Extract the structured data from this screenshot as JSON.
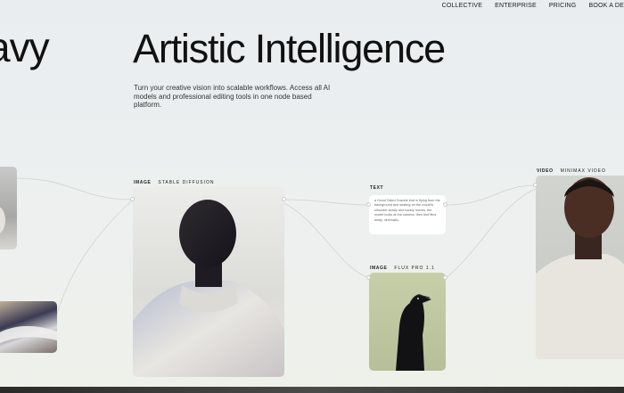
{
  "nav": {
    "items": [
      "COLLECTIVE",
      "ENTERPRISE",
      "PRICING",
      "BOOK A DE"
    ]
  },
  "brand": {
    "text": "avy"
  },
  "hero": {
    "title": "Artistic Intelligence",
    "subtitle": "Turn your creative vision into scalable workflows. Access all AI models and professional editing tools in one node based platform."
  },
  "nodes": {
    "stable": {
      "type": "IMAGE",
      "model": "STABLE DIFFUSION"
    },
    "text": {
      "type": "TEXT",
      "content": "a Great Tailed Grackle bird is flying from the background and seating on the model's shoulder slowly and barely moves. the model looks at the camera. then bird flies away, cinematic."
    },
    "flux": {
      "type": "IMAGE",
      "model": "FLUX PRO 1.1"
    },
    "video": {
      "type": "VIDEO",
      "model": "MINIMAX VIDEO"
    }
  },
  "colors": {
    "background": "#ebeeef",
    "wire": "#cfd2d0",
    "text": "#111111"
  }
}
